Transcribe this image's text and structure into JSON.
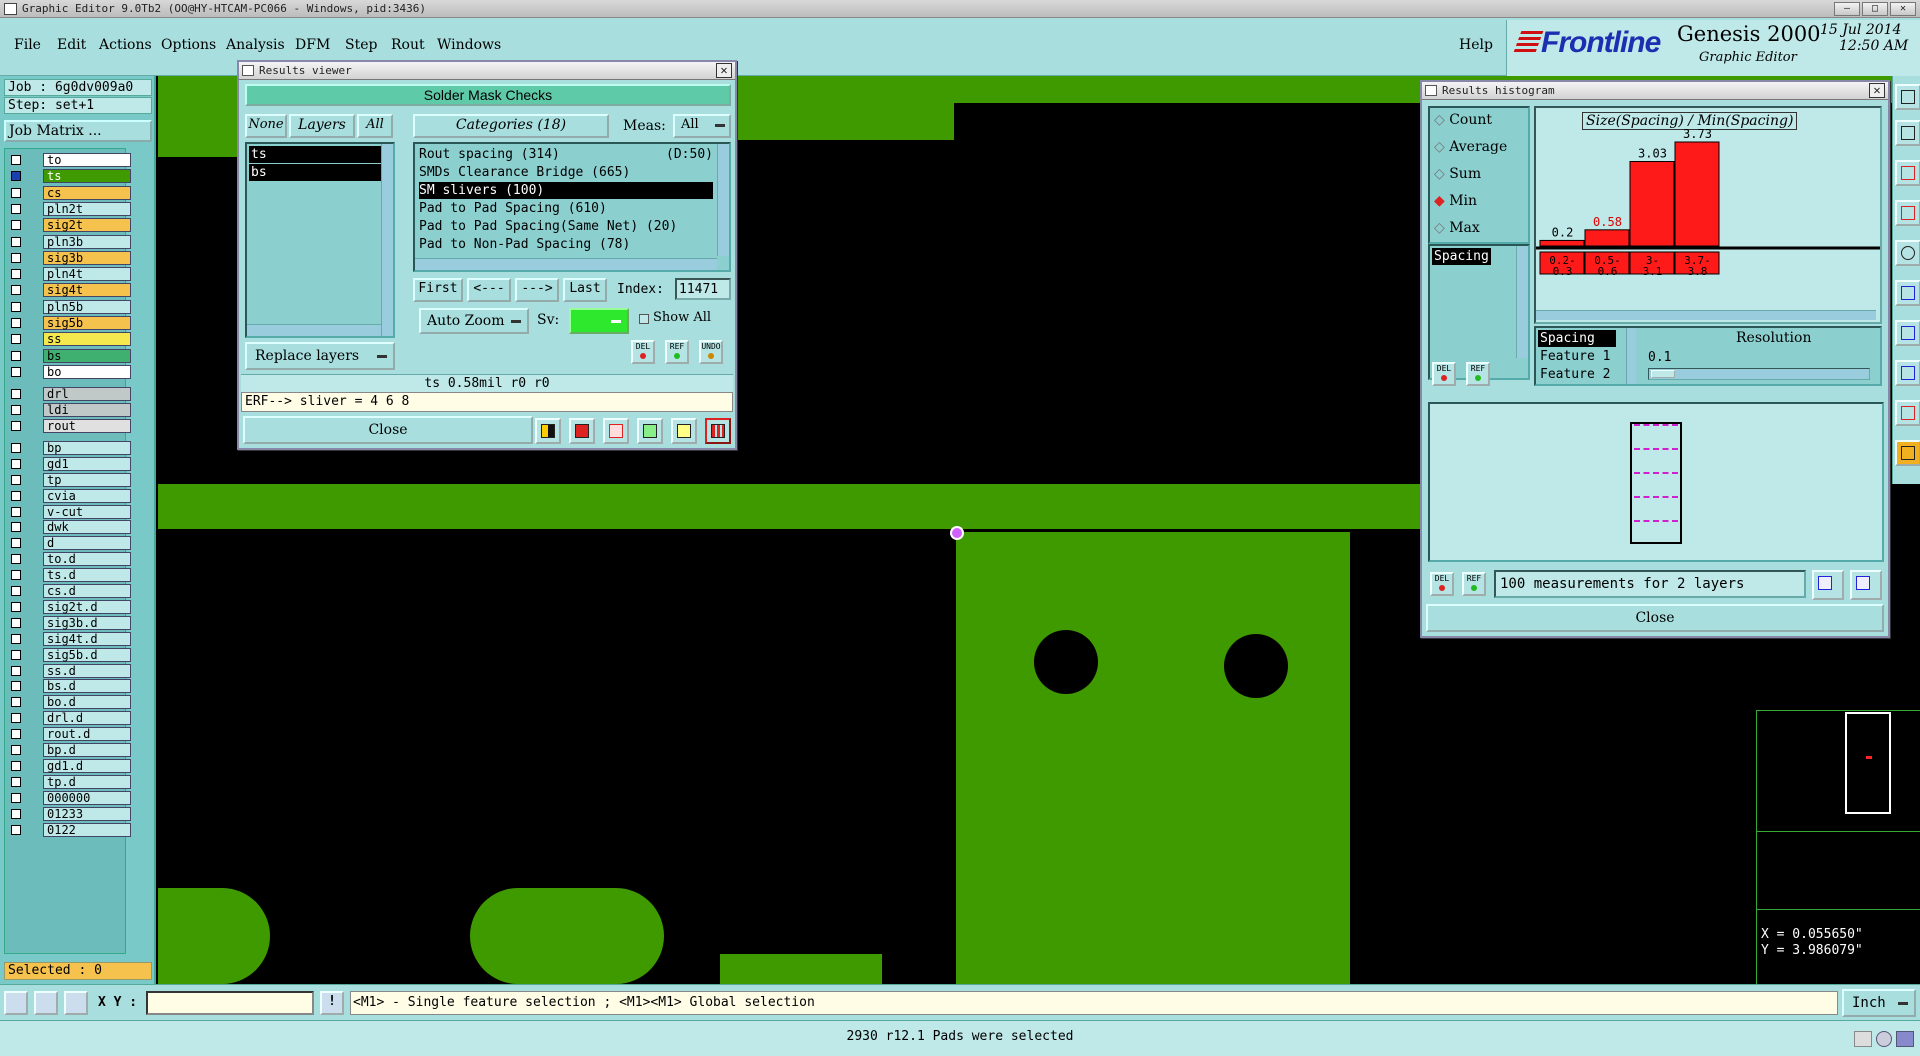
{
  "window": {
    "title": "Graphic Editor 9.0Tb2 (OO@HY-HTCAM-PC066 - Windows, pid:3436)",
    "min": "—",
    "max": "□",
    "close": "✕"
  },
  "menu": {
    "items": [
      "File",
      "Edit",
      "Actions",
      "Options",
      "Analysis",
      "DFM",
      "Step",
      "Rout",
      "Windows"
    ],
    "help": "Help"
  },
  "brand": {
    "logo": "Frontline",
    "product": "Genesis 2000",
    "subtitle": "Graphic Editor",
    "date": "15 Jul 2014",
    "time": "12:50 AM"
  },
  "left": {
    "job": "Job : 6g0dv009a0",
    "step": "Step: set+1",
    "job_matrix": "Job Matrix ...",
    "selected": "Selected : 0",
    "layers": [
      {
        "name": "to",
        "color": "#ffffff"
      },
      {
        "name": "ts",
        "color": "#3f9a00",
        "active": true
      },
      {
        "name": "cs",
        "color": "#f5c24e"
      },
      {
        "name": "pln2t",
        "color": "#bfe8e8"
      },
      {
        "name": "sig2t",
        "color": "#f5c24e"
      },
      {
        "name": "pln3b",
        "color": "#bfe8e8"
      },
      {
        "name": "sig3b",
        "color": "#f5c24e"
      },
      {
        "name": "pln4t",
        "color": "#bfe8e8"
      },
      {
        "name": "sig4t",
        "color": "#f5c24e"
      },
      {
        "name": "pln5b",
        "color": "#bfe8e8"
      },
      {
        "name": "sig5b",
        "color": "#f5c24e"
      },
      {
        "name": "ss",
        "color": "#f5e84e"
      },
      {
        "name": "bs",
        "color": "#3fb070"
      },
      {
        "name": "bo",
        "color": "#ffffff"
      },
      {
        "name": "drl",
        "color": "#c0c8c8"
      },
      {
        "name": "ldi",
        "color": "#c0c8c8"
      },
      {
        "name": "rout",
        "color": "#e0e0e0"
      },
      {
        "name": "bp",
        "color": "#bfe8e8"
      },
      {
        "name": "gd1",
        "color": "#bfe8e8"
      },
      {
        "name": "tp",
        "color": "#bfe8e8"
      },
      {
        "name": "cvia",
        "color": "#bfe8e8"
      },
      {
        "name": "v-cut",
        "color": "#bfe8e8"
      },
      {
        "name": "dwk",
        "color": "#bfe8e8"
      },
      {
        "name": "d",
        "color": "#bfe8e8"
      },
      {
        "name": "to.d",
        "color": "#bfe8e8"
      },
      {
        "name": "ts.d",
        "color": "#bfe8e8"
      },
      {
        "name": "cs.d",
        "color": "#bfe8e8"
      },
      {
        "name": "sig2t.d",
        "color": "#bfe8e8"
      },
      {
        "name": "sig3b.d",
        "color": "#bfe8e8"
      },
      {
        "name": "sig4t.d",
        "color": "#bfe8e8"
      },
      {
        "name": "sig5b.d",
        "color": "#bfe8e8"
      },
      {
        "name": "ss.d",
        "color": "#bfe8e8"
      },
      {
        "name": "bs.d",
        "color": "#bfe8e8"
      },
      {
        "name": "bo.d",
        "color": "#bfe8e8"
      },
      {
        "name": "drl.d",
        "color": "#bfe8e8"
      },
      {
        "name": "rout.d",
        "color": "#bfe8e8"
      },
      {
        "name": "bp.d",
        "color": "#bfe8e8"
      },
      {
        "name": "gd1.d",
        "color": "#bfe8e8"
      },
      {
        "name": "tp.d",
        "color": "#bfe8e8"
      },
      {
        "name": "000000",
        "color": "#bfe8e8"
      },
      {
        "name": "01233",
        "color": "#bfe8e8"
      },
      {
        "name": "0122",
        "color": "#bfe8e8"
      }
    ]
  },
  "results_viewer": {
    "title": "Results viewer",
    "header": "Solder Mask Checks",
    "none": "None",
    "layers": "Layers",
    "all": "All",
    "categories": "Categories (18)",
    "meas_label": "Meas:",
    "meas_value": "All",
    "layer_items": [
      "ts",
      "bs"
    ],
    "category_items": [
      {
        "label": "Rout spacing (314)",
        "suffix": "(D:50)"
      },
      {
        "label": "SMDs Clearance Bridge (665)",
        "suffix": ""
      },
      {
        "label": "SM slivers (100)",
        "suffix": "",
        "selected": true
      },
      {
        "label": "Pad to Pad Spacing (610)",
        "suffix": ""
      },
      {
        "label": "Pad to Pad Spacing(Same Net) (20)",
        "suffix": ""
      },
      {
        "label": "Pad to Non-Pad Spacing (78)",
        "suffix": ""
      }
    ],
    "first": "First",
    "prev": "<---",
    "next": "--->",
    "last": "Last",
    "index_label": "Index:",
    "index_value": "11471",
    "auto_zoom": "Auto Zoom",
    "sv_label": "Sv:",
    "show_all": "Show All",
    "replace_layers": "Replace layers",
    "del": "DEL",
    "ref": "REF",
    "undo": "UNDO",
    "info": "ts 0.58mil  r0  r0",
    "erf": "ERF--> sliver = 4 6 8",
    "close": "Close"
  },
  "histogram": {
    "title": "Results histogram",
    "options": [
      {
        "label": "Count",
        "selected": false
      },
      {
        "label": "Average",
        "selected": false
      },
      {
        "label": "Sum",
        "selected": false
      },
      {
        "label": "Min",
        "selected": true
      },
      {
        "label": "Max",
        "selected": false
      }
    ],
    "list_item": "Spacing",
    "del": "DEL",
    "ref": "REF",
    "selectors": [
      "Spacing",
      "Feature 1",
      "Feature 2"
    ],
    "resolution_label": "Resolution",
    "resolution_value": "0.1",
    "measurements": "100 measurements for 2 layers",
    "close": "Close"
  },
  "chart_data": {
    "type": "bar",
    "title": "Size(Spacing) / Min(Spacing)",
    "categories": [
      "0.2-0.3",
      "0.5-0.6",
      "3-3.1",
      "3.7-3.8"
    ],
    "values": [
      0.2,
      0.58,
      3.03,
      3.73
    ],
    "value_labels": [
      "0.2",
      "0.58",
      "3.03",
      "3.73"
    ],
    "highlight_index": 1,
    "bar_color": "#ff1a1a",
    "ylim": [
      0,
      3.73
    ]
  },
  "coords": {
    "x": "X = 0.055650\"",
    "y": "Y = 3.986079\""
  },
  "cmdbar": {
    "xy_label": "X Y :",
    "xy_value": "",
    "hint": "<M1> - Single feature selection ; <M1><M1> Global selection",
    "units": "Inch"
  },
  "status": {
    "text": "2930 r12.1 Pads were selected"
  }
}
